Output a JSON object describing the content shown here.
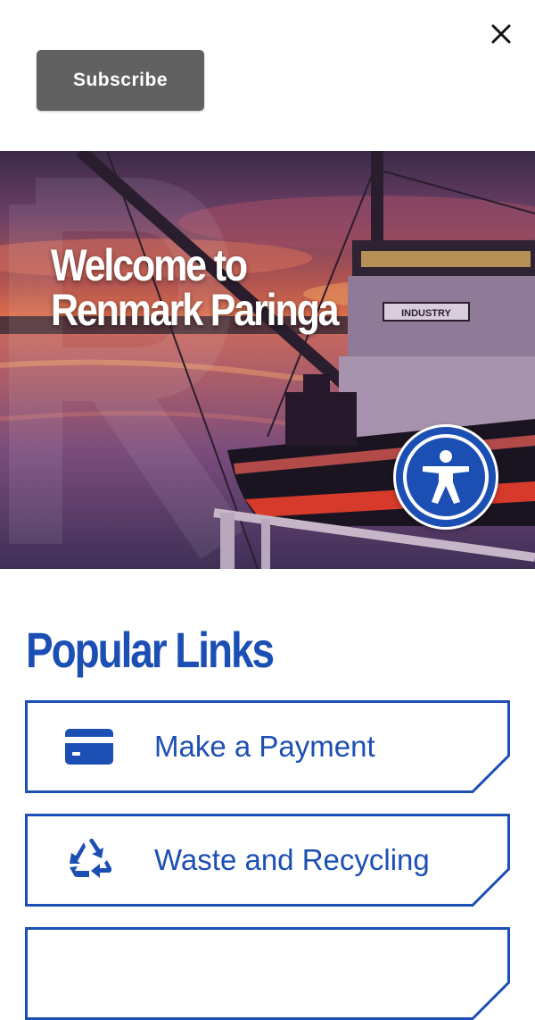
{
  "header": {
    "close_icon": "close-icon",
    "subscribe_label": "Subscribe"
  },
  "hero": {
    "title_line1": "Welcome to",
    "title_line2": "Renmark Paringa",
    "boat_sign": "INDUSTRY",
    "accessibility_icon": "accessibility-person-icon"
  },
  "popular_links": {
    "title": "Popular Links",
    "items": [
      {
        "label": "Make a Payment",
        "icon": "credit-card-icon"
      },
      {
        "label": "Waste and Recycling",
        "icon": "recycle-icon"
      },
      {
        "label": "",
        "icon": ""
      }
    ]
  },
  "colors": {
    "brand_blue": "#1c4fb4",
    "subscribe_bg": "#616161",
    "white": "#ffffff"
  }
}
